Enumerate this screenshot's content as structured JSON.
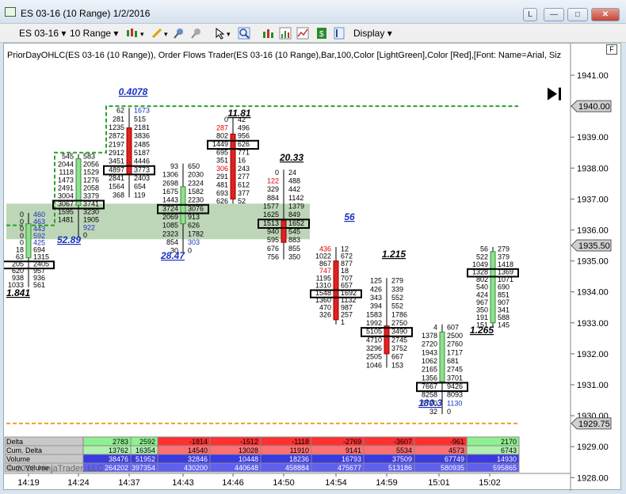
{
  "window": {
    "title": "ES 03-16 (10 Range)  1/2/2016",
    "btn_help": "L",
    "btn_min": "—",
    "btn_max": "□",
    "btn_close": "✕"
  },
  "toolbar": {
    "instrument": "ES 03-16",
    "period": "10 Range",
    "display": "Display"
  },
  "chart": {
    "indicator_text": "PriorDayOHLC(ES 03-16 (10 Range)),  Order Flows Trader(ES 03-16 (10 Range),Bar,100,Color [LightGreen],Color [Red],[Font: Name=Arial, Siz",
    "f_button": "F",
    "watermark": "© 2016 NinjaTrader, LLC",
    "price_labels": [
      "1941.00",
      "1940.00",
      "1939.00",
      "1938.00",
      "1937.00",
      "1936.00",
      "1935.00",
      "1934.00",
      "1933.00",
      "1932.00",
      "1931.00",
      "1930.00",
      "1929.00",
      "1928.00"
    ],
    "price_badges": {
      "high": "1940.00",
      "current": "1935.50",
      "low": "1929.75"
    },
    "time_labels": [
      "14:19",
      "14:24",
      "14:37",
      "14:43",
      "14:46",
      "14:50",
      "14:54",
      "14:59",
      "15:01",
      "15:02"
    ],
    "bar_deltas": [
      "1.841",
      "52.89",
      "0.4078",
      "28.47",
      "11.81",
      "20.33",
      "56",
      "1.215",
      "180.3",
      "1.265"
    ]
  },
  "table": {
    "rows": [
      "Delta",
      "Cum. Delta",
      "Volume",
      "Cum. Volume"
    ],
    "columns": [
      {
        "delta": "2783",
        "cum_delta": "13762",
        "volume": "38476",
        "cum_volume": "264202",
        "color": "green"
      },
      {
        "delta": "2592",
        "cum_delta": "16354",
        "volume": "51952",
        "cum_volume": "397354",
        "color": "green"
      },
      {
        "delta": "-1814",
        "cum_delta": "14540",
        "volume": "32846",
        "cum_volume": "430200",
        "color": "red"
      },
      {
        "delta": "-1512",
        "cum_delta": "13028",
        "volume": "10448",
        "cum_volume": "440648",
        "color": "red"
      },
      {
        "delta": "-1118",
        "cum_delta": "11910",
        "volume": "18236",
        "cum_volume": "458884",
        "color": "red"
      },
      {
        "delta": "-2769",
        "cum_delta": "9141",
        "volume": "16793",
        "cum_volume": "475677",
        "color": "red"
      },
      {
        "delta": "-3607",
        "cum_delta": "5534",
        "volume": "37509",
        "cum_volume": "513186",
        "color": "red"
      },
      {
        "delta": "-961",
        "cum_delta": "4573",
        "volume": "67749",
        "cum_volume": "580935",
        "color": "red"
      },
      {
        "delta": "2170",
        "cum_delta": "6743",
        "volume": "14930",
        "cum_volume": "595865",
        "color": "green"
      }
    ]
  },
  "footprints": [
    {
      "left": [
        "0",
        "0",
        "0",
        "0",
        "0",
        "18",
        "63",
        "205",
        "620",
        "938",
        "1033"
      ],
      "right": [
        "460",
        "463",
        "443",
        "592",
        "425",
        "694",
        "1315",
        "2405",
        "957",
        "936",
        "561"
      ],
      "right2": [
        "",
        "",
        "",
        "",
        "",
        "",
        "",
        "",
        "",
        "",
        "0"
      ]
    },
    {
      "left": [
        "545",
        "2044",
        "1118",
        "1473",
        "2491",
        "3004",
        "3067",
        "1595",
        "1481"
      ],
      "right": [
        "583",
        "2056",
        "1529",
        "1276",
        "2058",
        "3379",
        "3741",
        "3230",
        "1905",
        "922",
        "0"
      ]
    },
    {
      "left": [
        "62",
        "281",
        "1235",
        "2872",
        "2197",
        "2912",
        "3451",
        "4897",
        "2841",
        "1564",
        "368"
      ],
      "right": [
        "1673",
        "515",
        "2181",
        "3836",
        "2485",
        "5187",
        "4446",
        "3773",
        "2403",
        "654",
        "119"
      ]
    },
    {
      "left": [
        "93",
        "1306",
        "2698",
        "1675",
        "1443",
        "3724",
        "2069",
        "1085",
        "2323",
        "854",
        "30"
      ],
      "right": [
        "650",
        "2030",
        "2324",
        "1582",
        "2230",
        "3076",
        "913",
        "626",
        "1782",
        "303",
        "0"
      ]
    },
    {
      "left": [
        "0",
        "287",
        "802",
        "1449",
        "695",
        "351",
        "306",
        "291",
        "481",
        "693",
        "626"
      ],
      "right": [
        "42",
        "496",
        "956",
        "626",
        "771",
        "16",
        "243",
        "277",
        "612",
        "377",
        "52"
      ]
    },
    {
      "left": [
        "0",
        "122",
        "329",
        "884",
        "1577",
        "1625",
        "1513",
        "940",
        "595",
        "676",
        "756"
      ],
      "right": [
        "24",
        "488",
        "442",
        "1142",
        "1379",
        "849",
        "1652",
        "545",
        "883",
        "855",
        "350"
      ]
    },
    {
      "left": [
        "436",
        "1022",
        "867",
        "747",
        "1195",
        "1310",
        "1548",
        "1360",
        "470",
        "326"
      ],
      "right": [
        "12",
        "672",
        "877",
        "18",
        "707",
        "657",
        "1692",
        "1132",
        "987",
        "257",
        "1"
      ]
    },
    {
      "left": [
        "125",
        "426",
        "343",
        "394",
        "1583",
        "1992",
        "5105",
        "4710",
        "3296",
        "2505",
        "1046"
      ],
      "right": [
        "279",
        "339",
        "552",
        "552",
        "1786",
        "2750",
        "3490",
        "2745",
        "3752",
        "667",
        "153"
      ]
    },
    {
      "left": [
        "4",
        "1378",
        "2720",
        "1943",
        "1062",
        "2165",
        "1356",
        "7667",
        "8258",
        "5770",
        "32"
      ],
      "right": [
        "607",
        "2500",
        "2760",
        "1717",
        "681",
        "2745",
        "3701",
        "9426",
        "8093",
        "1130",
        "0"
      ]
    },
    {
      "left": [
        "56",
        "522",
        "1049",
        "1328",
        "802",
        "540",
        "424",
        "967",
        "350",
        "191",
        "151"
      ],
      "right": [
        "279",
        "379",
        "1418",
        "1369",
        "1071",
        "690",
        "851",
        "907",
        "341",
        "588",
        "145"
      ]
    }
  ]
}
